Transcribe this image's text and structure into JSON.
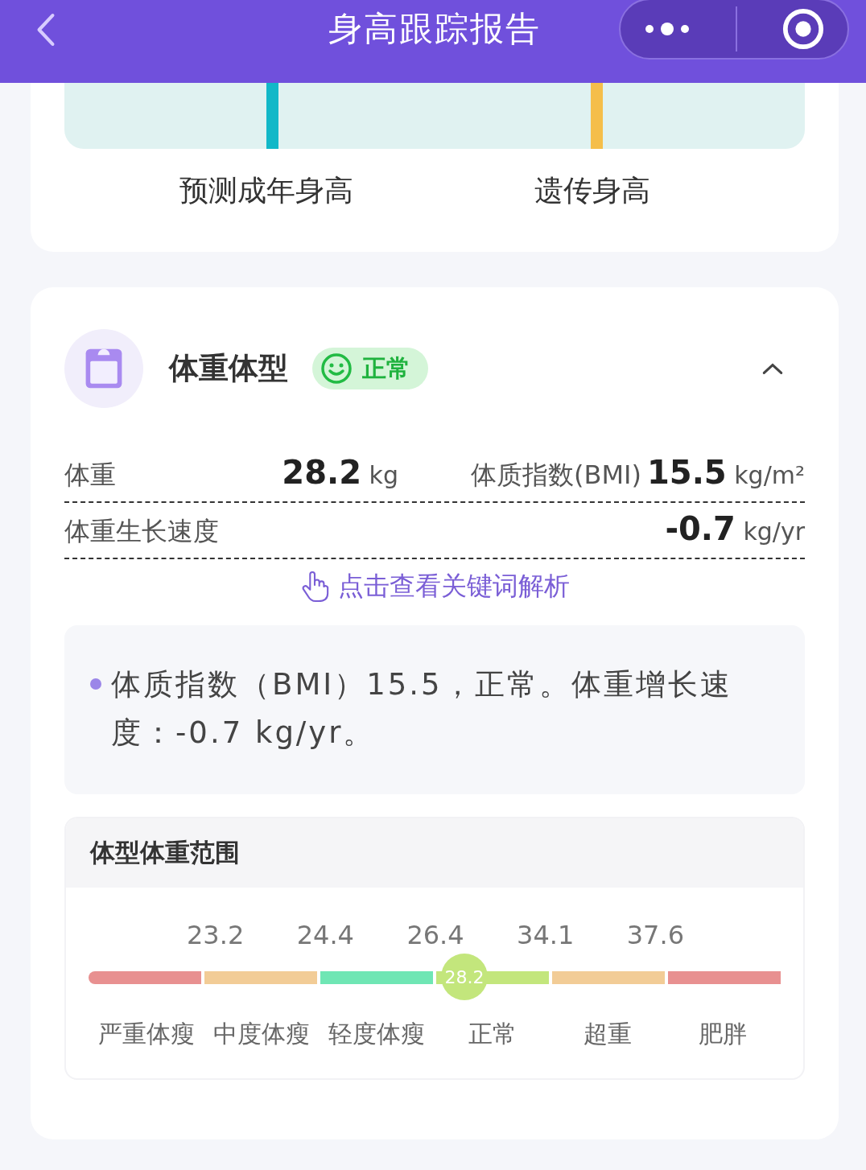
{
  "nav": {
    "title": "身高跟踪报告"
  },
  "height_card": {
    "labels": [
      "预测成年身高",
      "遗传身高"
    ]
  },
  "weight_card": {
    "title": "体重体型",
    "status": "正常",
    "expanded": true,
    "metrics": [
      {
        "label": "体重",
        "value": "28.2",
        "unit": "kg"
      },
      {
        "label": "体质指数(BMI)",
        "value": "15.5",
        "unit": "kg/m²"
      },
      {
        "label": "体重生长速度",
        "value": "-0.7",
        "unit": "kg/yr"
      }
    ],
    "link": "点击查看关键词解析",
    "summary": "体质指数（BMI）15.5，正常。体重增长速度：-0.7 kg/yr。",
    "range": {
      "title": "体型体重范围",
      "thresholds": [
        "23.2",
        "24.4",
        "26.4",
        "34.1",
        "37.6"
      ],
      "segments": [
        {
          "label": "严重体瘦",
          "color": "#e89090"
        },
        {
          "label": "中度体瘦",
          "color": "#f2cc96"
        },
        {
          "label": "轻度体瘦",
          "color": "#6fe6b4"
        },
        {
          "label": "正常",
          "color": "#c3e67c"
        },
        {
          "label": "超重",
          "color": "#f2cc96"
        },
        {
          "label": "肥胖",
          "color": "#e89090"
        }
      ],
      "marker": {
        "value": "28.2",
        "level": 0.543
      }
    }
  }
}
